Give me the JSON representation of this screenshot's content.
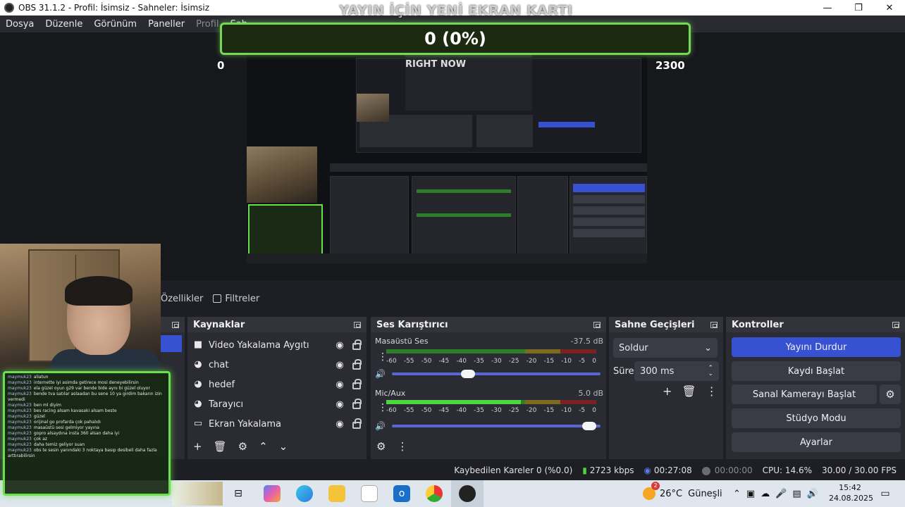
{
  "window": {
    "title": "OBS 31.1.2 - Profil: İsimsiz - Sahneler: İsimsiz",
    "minimize": "—",
    "maximize": "❐",
    "close": "✕"
  },
  "menu": [
    "Dosya",
    "Düzenle",
    "Görünüm",
    "Paneller",
    "Profil",
    "Sah"
  ],
  "overlay": {
    "goal_title": "YAYIN İÇİN YENİ EKRAN KARTI",
    "goal_progress_text": "0 (0%)",
    "goal_progress_fraction": 0,
    "goal_min": "0",
    "goal_max": "2300",
    "subtitle": "RIGHT NOW"
  },
  "chat": [
    {
      "user": "maymuk23",
      "msg": "aliatun"
    },
    {
      "user": "maymuk23",
      "msg": "internette iyi asimda getirece mosi deneyebilirsin"
    },
    {
      "user": "maymuk23",
      "msg": "ela güzel oyun g29 var bende bide aynı bi güzel oluyor"
    },
    {
      "user": "maymuk23",
      "msg": "bende tva satılar aslaadan bu sene 10 ya girdim bakarın izin vermedi"
    },
    {
      "user": "maymuk23",
      "msg": "ben ml diyim"
    },
    {
      "user": "maymuk23",
      "msg": "bes racing alsam kavasaki alsam beste"
    },
    {
      "user": "maymuk23",
      "msg": "güzel"
    },
    {
      "user": "maymuk23",
      "msg": "orijinal go profarda çok pahalıdı"
    },
    {
      "user": "maymuk23",
      "msg": "masaüstü sesi gelmiyor yayına"
    },
    {
      "user": "maymuk23",
      "msg": "gopro alsaydına insta 360 alsan daha iyi"
    },
    {
      "user": "maymuk23",
      "msg": "çok az"
    },
    {
      "user": "maymuk23",
      "msg": "daha temiz geliyor suan"
    },
    {
      "user": "maymuk23",
      "msg": "obs te sesin yanındaki 3 noktaya basıp desibeli daha fazla arttırabilirsin"
    }
  ],
  "tabs": {
    "properties": "Özellikler",
    "filters": "Filtreler"
  },
  "sources": {
    "title": "Kaynaklar",
    "items": [
      {
        "icon": "camera-icon",
        "name": "Video Yakalama Aygıtı"
      },
      {
        "icon": "browser-icon",
        "name": "chat"
      },
      {
        "icon": "browser-icon",
        "name": "hedef"
      },
      {
        "icon": "browser-icon",
        "name": "Tarayıcı"
      },
      {
        "icon": "monitor-icon",
        "name": "Ekran Yakalama"
      }
    ]
  },
  "mixer": {
    "title": "Ses Karıştırıcı",
    "channels": [
      {
        "name": "Masaüstü Ses",
        "db": "-37.5 dB",
        "level": 0.0,
        "volume": 0.4
      },
      {
        "name": "Mic/Aux",
        "db": "5.0 dB",
        "level": 0.64,
        "volume": 0.98
      }
    ],
    "ticks": [
      "-60",
      "-55",
      "-50",
      "-45",
      "-40",
      "-35",
      "-30",
      "-25",
      "-20",
      "-15",
      "-10",
      "-5",
      "0"
    ]
  },
  "transitions": {
    "title": "Sahne Geçişleri",
    "selected": "Soldur",
    "duration_label": "Süre",
    "duration_value": "300 ms"
  },
  "controls": {
    "title": "Kontroller",
    "stop_stream": "Yayını Durdur",
    "start_record": "Kaydı Başlat",
    "start_virtual_cam": "Sanal Kamerayı Başlat",
    "studio_mode": "Stüdyo Modu",
    "settings": "Ayarlar"
  },
  "status": {
    "dropped": "Kaybedilen Kareler 0 (%0.0)",
    "bitrate": "2723 kbps",
    "stream_time": "00:27:08",
    "record_time": "00:00:00",
    "cpu": "CPU: 14.6%",
    "fps": "30.00 / 30.00 FPS"
  },
  "taskbar": {
    "weather_temp": "26°C",
    "weather_text": "Güneşli",
    "weather_badge": "2",
    "time": "15:42",
    "date": "24.08.2025",
    "colors": {
      "accent": "#3651d1",
      "goal_green": "#75d955"
    }
  }
}
